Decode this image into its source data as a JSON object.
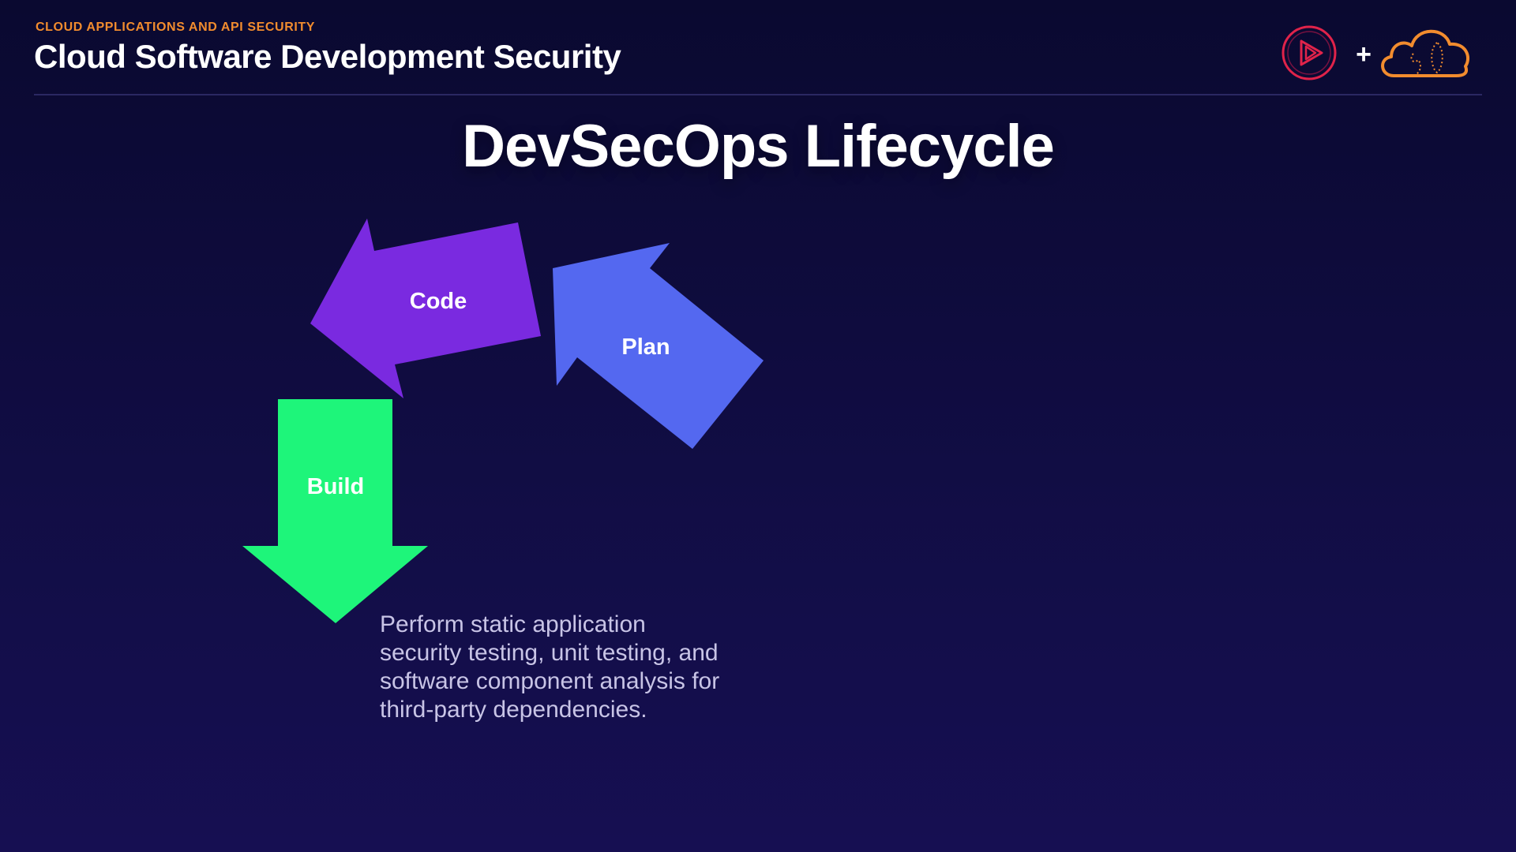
{
  "header": {
    "kicker": "CLOUD APPLICATIONS AND API SECURITY",
    "course_title": "Cloud Software Development Security",
    "plus": "+"
  },
  "slide": {
    "title": "DevSecOps Lifecycle",
    "description": "Perform static application security testing, unit testing, and software component analysis for third-party dependencies."
  },
  "lifecycle": {
    "stages": [
      {
        "label": "Plan",
        "color": "#5468f0"
      },
      {
        "label": "Code",
        "color": "#7a2ae0"
      },
      {
        "label": "Build",
        "color": "#1ef57a"
      }
    ]
  },
  "colors": {
    "accent_orange": "#f28c2e",
    "pluralsight_red": "#e0234a"
  }
}
